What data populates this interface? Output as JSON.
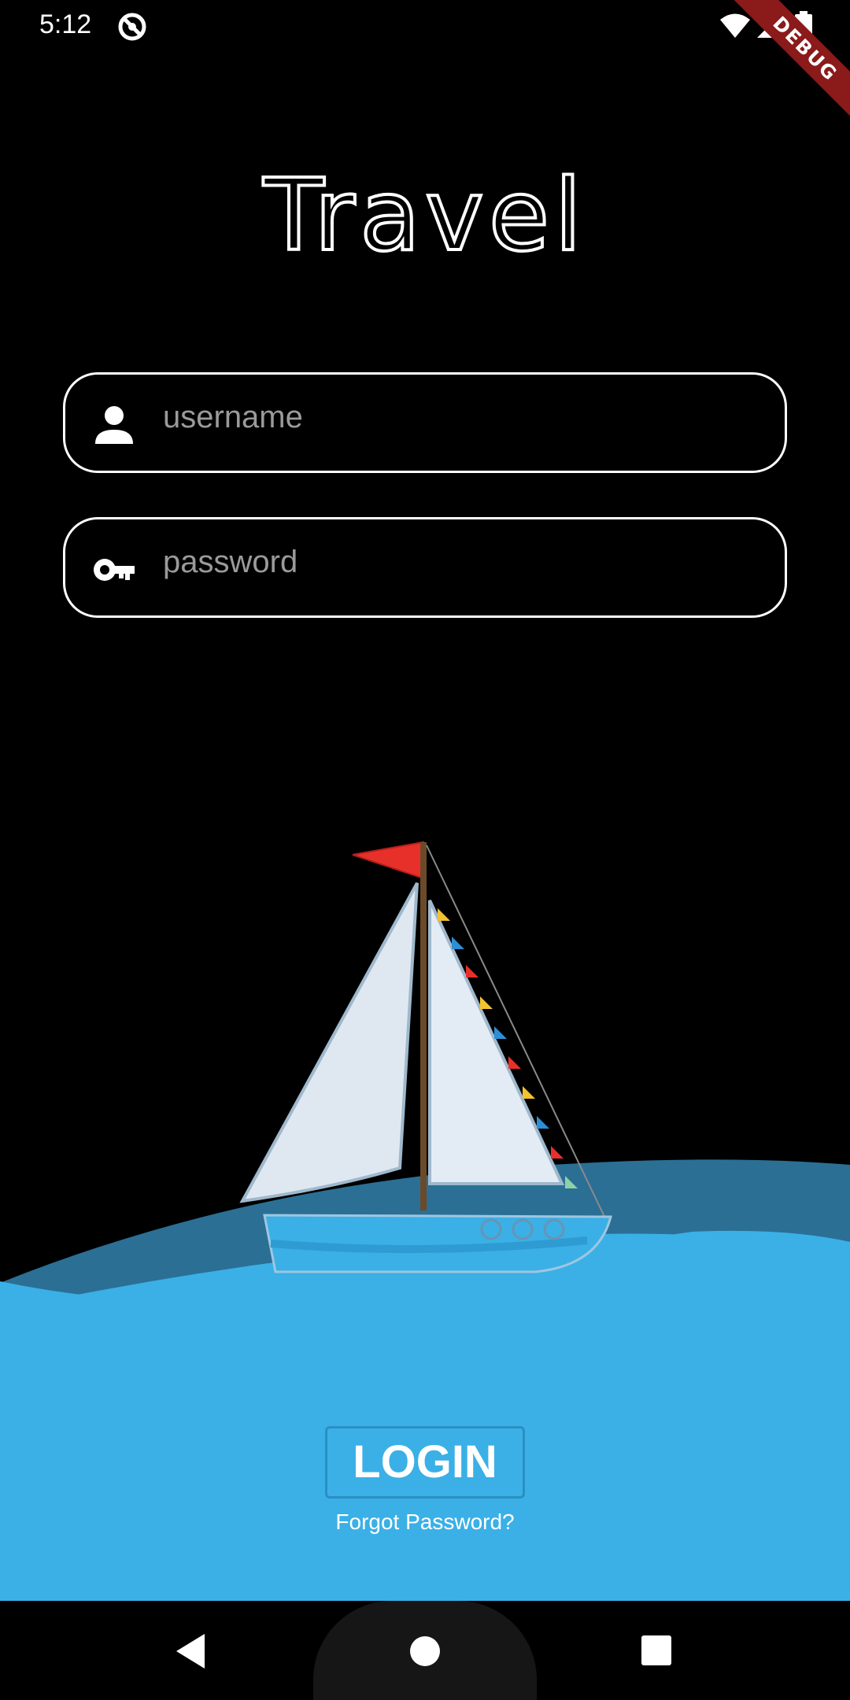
{
  "status_bar": {
    "time": "5:12",
    "icons": [
      "app-notification-icon",
      "wifi-icon",
      "signal-icon",
      "battery-icon"
    ]
  },
  "debug_banner": "DEBUG",
  "app": {
    "title": "Travel"
  },
  "form": {
    "username": {
      "placeholder": "username",
      "value": "",
      "icon": "person-icon"
    },
    "password": {
      "placeholder": "password",
      "value": "",
      "icon": "key-icon"
    }
  },
  "actions": {
    "login_label": "LOGIN",
    "forgot_label": "Forgot Password?"
  },
  "colors": {
    "background": "#000000",
    "sea": "#3ab0e6",
    "sea_dark": "#2b6f95",
    "flag": "#e8302a",
    "button_border": "#2b8fc2"
  },
  "nav": {
    "icons": [
      "back-icon",
      "home-icon",
      "recents-icon"
    ]
  }
}
